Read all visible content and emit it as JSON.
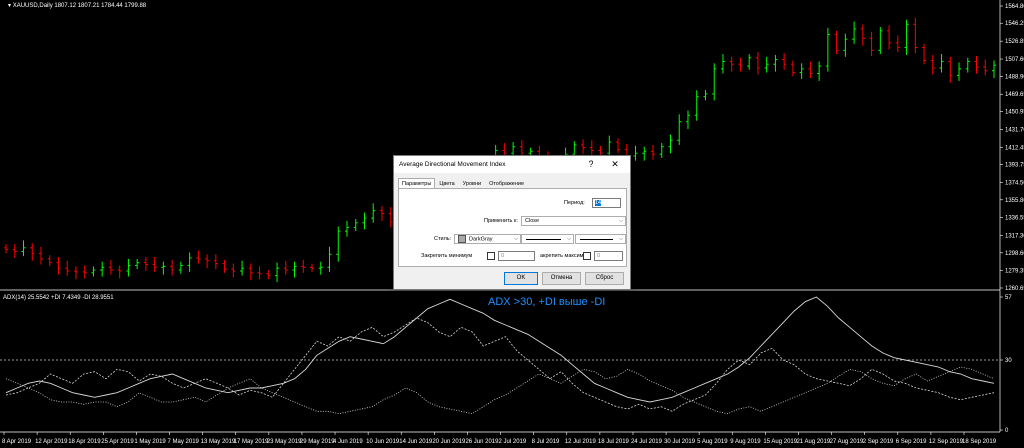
{
  "chart": {
    "header": "XAUUSD,Daily  1807.12 1807.21 1784.44 1799.88",
    "price_ticks": [
      "1564.80",
      "1546.25",
      "1526.85",
      "1507.60",
      "1488.90",
      "1469.65",
      "1450.95",
      "1431.70",
      "1412.45",
      "1393.75",
      "1374.50",
      "1355.80",
      "1336.55",
      "1317.30",
      "1298.60",
      "1279.35",
      "1260.65"
    ],
    "date_ticks": [
      "8 Apr 2019",
      "12 Apr 2019",
      "18 Apr 2019",
      "25 Apr 2019",
      "1 May 2019",
      "7 May 2019",
      "13 May 2019",
      "17 May 2019",
      "23 May 2019",
      "29 May 2019",
      "4 Jun 2019",
      "10 Jun 2019",
      "14 Jun 2019",
      "20 Jun 2019",
      "26 Jun 2019",
      "2 Jul 2019",
      "8 Jul 2019",
      "12 Jul 2019",
      "18 Jul 2019",
      "24 Jul 2019",
      "30 Jul 2019",
      "5 Aug 2019",
      "9 Aug 2019",
      "15 Aug 2019",
      "21 Aug 2019",
      "27 Aug 2019",
      "2 Sep 2019",
      "6 Sep 2019",
      "12 Sep 2019",
      "18 Sep 2019"
    ],
    "closes": [
      1302,
      1300,
      1304,
      1298,
      1292,
      1288,
      1282,
      1279,
      1278,
      1277,
      1280,
      1283,
      1280,
      1279,
      1285,
      1288,
      1286,
      1283,
      1284,
      1280,
      1285,
      1293,
      1292,
      1290,
      1287,
      1281,
      1279,
      1282,
      1277,
      1276,
      1274,
      1282,
      1280,
      1284,
      1283,
      1282,
      1283,
      1297,
      1322,
      1326,
      1331,
      1336,
      1344,
      1341,
      1332,
      1331,
      1328,
      1332,
      1342,
      1346,
      1345,
      1353,
      1359,
      1370,
      1381,
      1388,
      1409,
      1406,
      1413,
      1406,
      1408,
      1400,
      1396,
      1394,
      1405,
      1415,
      1412,
      1409,
      1406,
      1418,
      1410,
      1403,
      1406,
      1408,
      1405,
      1413,
      1420,
      1440,
      1447,
      1467,
      1470,
      1497,
      1505,
      1502,
      1500,
      1509,
      1498,
      1502,
      1507,
      1502,
      1493,
      1497,
      1492,
      1500,
      1534,
      1517,
      1529,
      1540,
      1530,
      1517,
      1538,
      1525,
      1520,
      1545,
      1520,
      1506,
      1498,
      1505,
      1490,
      1497,
      1505,
      1499,
      1495,
      1501
    ],
    "indicator_header": "ADX(14) 25.5542 +DI 7.4349 -DI 28.9551",
    "indicator_ticks": {
      "top": "57",
      "level": "30",
      "bottom": "0"
    },
    "level": 30,
    "annotation": "ADX >30, +DI выше -DI",
    "adx": [
      16,
      18,
      20,
      21,
      20,
      18,
      16,
      15,
      14,
      15,
      16,
      18,
      20,
      22,
      23,
      24,
      22,
      20,
      18,
      17,
      16,
      17,
      18,
      18,
      19,
      20,
      22,
      26,
      32,
      35,
      38,
      40,
      39,
      38,
      37,
      40,
      44,
      48,
      52,
      54,
      56,
      54,
      52,
      50,
      47,
      45,
      43,
      41,
      38,
      35,
      32,
      28,
      24,
      20,
      18,
      16,
      14,
      13,
      12,
      13,
      14,
      16,
      18,
      20,
      22,
      24,
      27,
      31,
      36,
      41,
      46,
      51,
      55,
      57,
      53,
      48,
      44,
      40,
      36,
      33,
      31,
      30,
      29,
      28,
      27,
      25,
      24,
      22,
      21,
      20
    ],
    "plus_di": [
      15,
      16,
      18,
      20,
      24,
      22,
      20,
      24,
      25,
      22,
      26,
      25,
      21,
      24,
      23,
      20,
      18,
      20,
      22,
      20,
      18,
      15,
      17,
      16,
      14,
      20,
      26,
      32,
      38,
      36,
      40,
      38,
      42,
      44,
      40,
      42,
      45,
      48,
      46,
      42,
      40,
      44,
      42,
      36,
      38,
      40,
      34,
      30,
      26,
      22,
      25,
      20,
      16,
      14,
      12,
      10,
      9,
      11,
      9,
      10,
      8,
      11,
      13,
      15,
      20,
      26,
      30,
      28,
      33,
      35,
      30,
      28,
      24,
      22,
      21,
      20,
      19,
      22,
      26,
      24,
      21,
      20,
      18,
      17,
      16,
      14,
      13,
      14,
      15,
      16
    ],
    "minus_di": [
      22,
      20,
      18,
      16,
      13,
      12,
      12,
      11,
      12,
      12,
      10,
      12,
      16,
      14,
      12,
      12,
      13,
      14,
      12,
      15,
      18,
      20,
      22,
      18,
      16,
      14,
      12,
      10,
      8,
      8,
      7,
      8,
      9,
      10,
      13,
      15,
      18,
      16,
      12,
      10,
      9,
      8,
      7,
      10,
      13,
      15,
      18,
      21,
      24,
      22,
      20,
      23,
      26,
      25,
      22,
      23,
      26,
      24,
      21,
      19,
      17,
      14,
      12,
      10,
      8,
      7,
      9,
      10,
      8,
      10,
      12,
      14,
      16,
      18,
      20,
      23,
      26,
      25,
      22,
      20,
      19,
      22,
      24,
      21,
      23,
      25,
      27,
      26,
      24,
      22
    ]
  },
  "dialog": {
    "title": "Average Directional Movement Index",
    "help": "?",
    "close": "✕",
    "tabs": [
      "Параметры",
      "Цвета",
      "Уровни",
      "Отображение"
    ],
    "period_label": "Период:",
    "period_value": "14",
    "apply_label": "Применить к:",
    "apply_value": "Close",
    "style_label": "Стиль:",
    "style_color": "DarkGray",
    "fix_min_label": "Закрепить минимум",
    "fix_min_value": "0",
    "fix_max_label": "акрепить максимум",
    "fix_max_value": "0",
    "ok": "OK",
    "cancel": "Отмена",
    "reset": "Сброс"
  },
  "colors": {
    "bull": "#00ff00",
    "bear": "#ff0000",
    "annotation": "#1e90ff"
  }
}
